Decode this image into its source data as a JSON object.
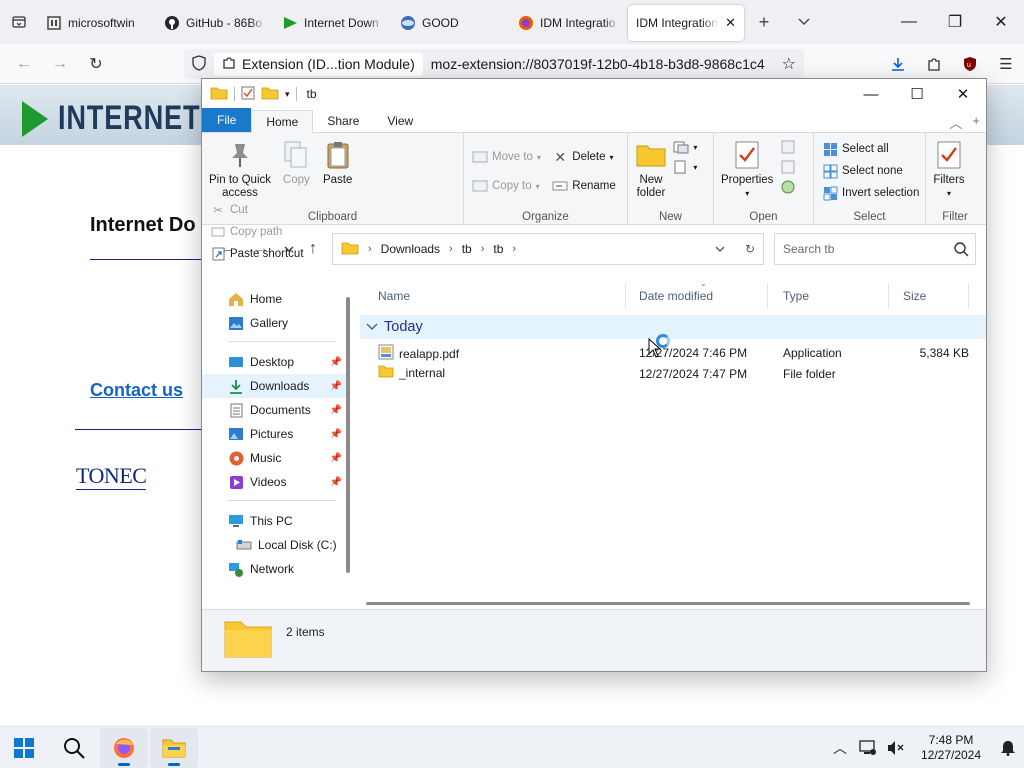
{
  "browser": {
    "tabs": [
      {
        "title": "microsoftwin",
        "icon": "website-icon"
      },
      {
        "title": "GitHub - 86Bo",
        "icon": "github-icon"
      },
      {
        "title": "Internet Down",
        "icon": "idm-icon"
      },
      {
        "title": "GOOD",
        "icon": "globe-icon"
      },
      {
        "title": "IDM Integratio",
        "icon": "firefox-icon"
      },
      {
        "title": "IDM Integration",
        "icon": "none",
        "active": true
      }
    ],
    "address": {
      "extension_label": "Extension (ID...tion Module)",
      "url": "moz-extension://8037019f-12b0-4b18-b3d8-9868c1c4"
    }
  },
  "webpage": {
    "banner_text": "INTERNET D",
    "heading": "Internet Do",
    "contact_link": "Contact us",
    "logo_text": "TONEC"
  },
  "explorer": {
    "title": "tb",
    "ribbon_tabs": [
      "File",
      "Home",
      "Share",
      "View"
    ],
    "active_tab": "Home",
    "clipboard": {
      "label": "Clipboard",
      "pin": "Pin to Quick access",
      "pin_line1": "Pin to Quick",
      "pin_line2": "access",
      "copy": "Copy",
      "paste": "Paste",
      "cut": "Cut",
      "copy_path": "Copy path",
      "paste_shortcut": "Paste shortcut"
    },
    "organize": {
      "label": "Organize",
      "move_to": "Move to",
      "copy_to": "Copy to",
      "delete": "Delete",
      "rename": "Rename"
    },
    "new": {
      "label": "New",
      "new_folder_line1": "New",
      "new_folder_line2": "folder"
    },
    "open": {
      "label": "Open",
      "properties": "Properties"
    },
    "select": {
      "label": "Select",
      "select_all": "Select all",
      "select_none": "Select none",
      "invert": "Invert selection"
    },
    "filter": {
      "label": "Filter",
      "filters": "Filters"
    },
    "breadcrumb": [
      "Downloads",
      "tb",
      "tb"
    ],
    "search_placeholder": "Search tb",
    "nav_pane": {
      "quick": [
        "Home",
        "Gallery"
      ],
      "pinned": [
        "Desktop",
        "Downloads",
        "Documents",
        "Pictures",
        "Music",
        "Videos"
      ],
      "pc": "This PC",
      "disk": "Local Disk (C:)",
      "network": "Network",
      "selected": "Downloads"
    },
    "columns": [
      "Name",
      "Date modified",
      "Type",
      "Size"
    ],
    "group_label": "Today",
    "files": [
      {
        "name": "realapp.pdf",
        "date": "12/27/2024 7:46 PM",
        "type": "Application",
        "size": "5,384 KB",
        "icon": "application-file-icon"
      },
      {
        "name": "_internal",
        "date": "12/27/2024 7:47 PM",
        "type": "File folder",
        "size": "",
        "icon": "folder-icon"
      }
    ],
    "status": "2 items"
  },
  "taskbar": {
    "time": "7:48 PM",
    "date": "12/27/2024"
  },
  "colors": {
    "accent": "#1979ca",
    "selection": "#e5f3ff",
    "link": "#1565c0",
    "folder": "#f8c830"
  }
}
